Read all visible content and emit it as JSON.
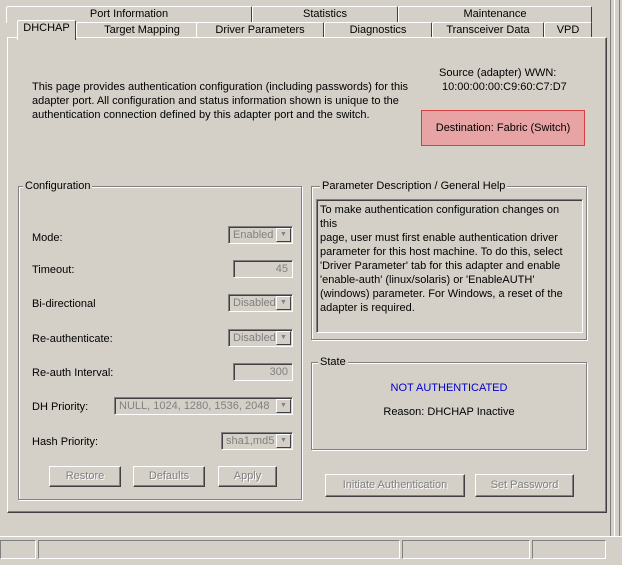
{
  "tabs_back": [
    {
      "label": "Port Information"
    },
    {
      "label": "Statistics"
    },
    {
      "label": "Maintenance"
    }
  ],
  "tabs_front": [
    {
      "label": "DHCHAP"
    },
    {
      "label": "Target Mapping"
    },
    {
      "label": "Driver Parameters"
    },
    {
      "label": "Diagnostics"
    },
    {
      "label": "Transceiver Data"
    },
    {
      "label": "VPD"
    }
  ],
  "intro": {
    "line1": "This page provides authentication configuration (including passwords) for this",
    "line2": "adapter port. All configuration and status information shown is unique to the",
    "line3": "authentication connection defined by this adapter port and the switch."
  },
  "source": {
    "label": "Source (adapter) WWN:",
    "wwn": "10:00:00:00:C9:60:C7:D7"
  },
  "destination": {
    "text": "Destination:  Fabric (Switch)",
    "bg_color": "#e8a4a4",
    "border_color": "#d44040"
  },
  "configuration": {
    "title": "Configuration",
    "mode_label": "Mode:",
    "mode_value": "Enabled",
    "timeout_label": "Timeout:",
    "timeout_value": "45",
    "bidir_label": "Bi-directional",
    "bidir_value": "Disabled",
    "reauth_label": "Re-authenticate:",
    "reauth_value": "Disabled",
    "reauth_interval_label": "Re-auth Interval:",
    "reauth_interval_value": "300",
    "dh_label": "DH Priority:",
    "dh_value": "NULL, 1024, 1280, 1536, 2048",
    "hash_label": "Hash Priority:",
    "hash_value": "sha1,md5",
    "restore_label": "Restore",
    "defaults_label": "Defaults",
    "apply_label": "Apply"
  },
  "help": {
    "title": "Parameter Description / General Help",
    "l1": "To make authentication configuration changes on this",
    "l2": "page, user must first enable authentication driver",
    "l3": "parameter for this host machine. To do this, select",
    "l4": "'Driver Parameter' tab for this adapter and enable",
    "l5": "'enable-auth' (linux/solaris) or 'EnableAUTH'",
    "l6": "(windows) parameter. For Windows, a reset of the",
    "l7": "adapter is required."
  },
  "state": {
    "title": "State",
    "status": "NOT AUTHENTICATED",
    "status_color": "#0000cc",
    "reason": "Reason: DHCHAP Inactive"
  },
  "actions": {
    "initiate_label": "Initiate Authentication",
    "set_password_label": "Set Password"
  },
  "icons": {
    "combo_arrow": "chevron-down-icon"
  }
}
